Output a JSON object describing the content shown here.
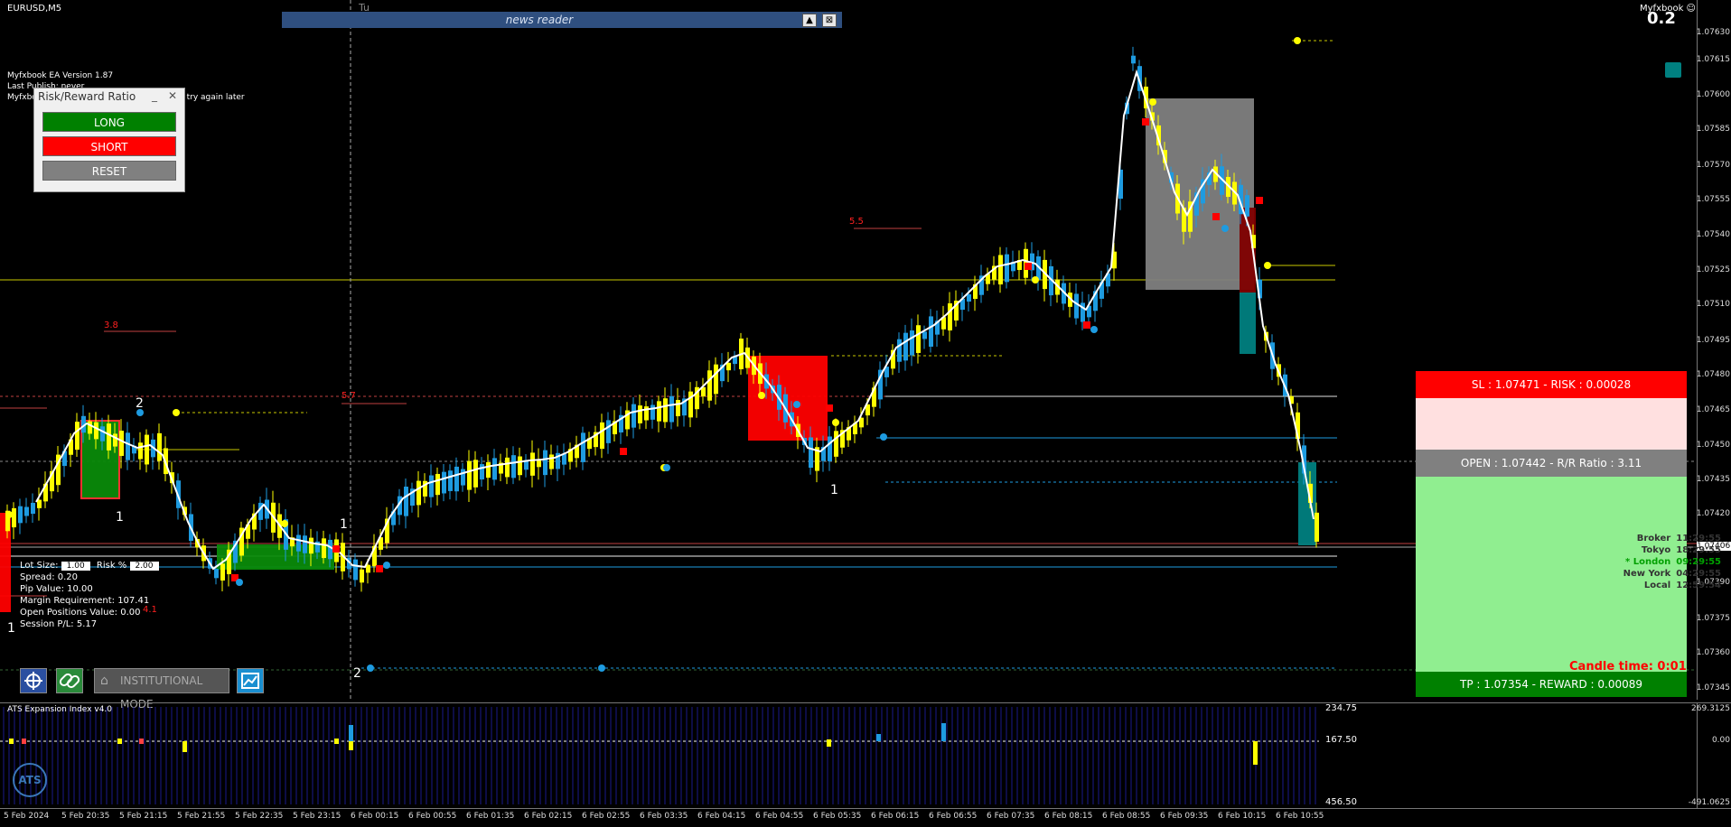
{
  "header": {
    "symbol": "EURUSD,M5",
    "myfxbook_label": "Myfxbook ☺",
    "top_value": "0.2",
    "day_label": "Tu"
  },
  "news_reader": {
    "title": "news reader",
    "collapse_icon": "▲",
    "close_icon": "⊠"
  },
  "ea_info": {
    "lines": [
      "Myfxbook EA Version 1.87",
      "Last Publish: never",
      "Myfxbook                                           Please try again later"
    ]
  },
  "rr_panel": {
    "title": "Risk/Reward Ratio",
    "minimize": "_",
    "close": "✕",
    "long_label": "LONG",
    "short_label": "SHORT",
    "reset_label": "RESET",
    "long_color": "#008000",
    "short_color": "#ff0000",
    "reset_color": "#808080"
  },
  "calc_panel": {
    "lot_label": "Lot Size:",
    "lot_value": "1.00",
    "risk_label": "Risk %",
    "risk_value": "2.00",
    "spread": "Spread: 0.20",
    "pip_value": "Pip Value: 10.00",
    "margin": "Margin Requirement: 107.41",
    "open_positions": "Open Positions Value: 0.00",
    "session_pl": "Session P/L: 5.17"
  },
  "toolbar": {
    "institutional_label": "INSTITUTIONAL MODE",
    "crosshair_icon": "crosshair-icon",
    "link_icon": "link-icon",
    "screenshot_icon": "chart-screenshot-icon"
  },
  "rr_box": {
    "sl": "SL : 1.07471 - RISK : 0.00028",
    "open": "OPEN : 1.07442 - R/R Ratio : 3.11",
    "tp": "TP : 1.07354 - REWARD : 0.00089"
  },
  "sessions": [
    {
      "name": "Broker",
      "time": "11:29:55"
    },
    {
      "name": "Tokyo",
      "time": "18:29:55"
    },
    {
      "name": "* London",
      "time": "09:29:55"
    },
    {
      "name": "New York",
      "time": "04:29:55"
    },
    {
      "name": "Local",
      "time": "12:59:54"
    }
  ],
  "candle_time": "Candle time: 0:01",
  "annotations": [
    {
      "text": "2",
      "color": "white"
    },
    {
      "text": "1",
      "color": "white"
    },
    {
      "text": "1",
      "color": "white"
    },
    {
      "text": "1",
      "color": "white"
    },
    {
      "text": "2",
      "color": "white"
    },
    {
      "text": "1",
      "color": "white"
    },
    {
      "text": "3.8",
      "color": "red"
    },
    {
      "text": "5.5",
      "color": "red"
    },
    {
      "text": "5.7",
      "color": "red"
    },
    {
      "text": "4.1",
      "color": "red"
    }
  ],
  "price_axis": {
    "ticks": [
      "1.07630",
      "1.07615",
      "1.07600",
      "1.07585",
      "1.07570",
      "1.07555",
      "1.07540",
      "1.07525",
      "1.07510",
      "1.07495",
      "1.07480",
      "1.07465",
      "1.07450",
      "1.07435",
      "1.07420",
      "1.07390",
      "1.07375",
      "1.07360",
      "1.07345"
    ],
    "current_price": "1.07406"
  },
  "sub_window": {
    "title": "ATS Expansion Index v4.0",
    "inner_ticks": [
      "234.75",
      "167.50",
      "456.50"
    ],
    "axis_ticks": [
      "269.3125",
      "0.00",
      "-491.0625"
    ],
    "logo": "ATS"
  },
  "time_axis": {
    "ticks": [
      "5 Feb 2024",
      "5 Feb 20:35",
      "5 Feb 21:15",
      "5 Feb 21:55",
      "5 Feb 22:35",
      "5 Feb 23:15",
      "6 Feb 00:15",
      "6 Feb 00:55",
      "6 Feb 01:35",
      "6 Feb 02:15",
      "6 Feb 02:55",
      "6 Feb 03:35",
      "6 Feb 04:15",
      "6 Feb 04:55",
      "6 Feb 05:35",
      "6 Feb 06:15",
      "6 Feb 06:55",
      "6 Feb 07:35",
      "6 Feb 08:15",
      "6 Feb 08:55",
      "6 Feb 09:35",
      "6 Feb 10:15",
      "6 Feb 10:55"
    ]
  },
  "colors": {
    "bull_candle": "#1e9be0",
    "bear_candle": "#ffff00",
    "ma_line": "#ffffff",
    "chart_bg": "#000000"
  }
}
